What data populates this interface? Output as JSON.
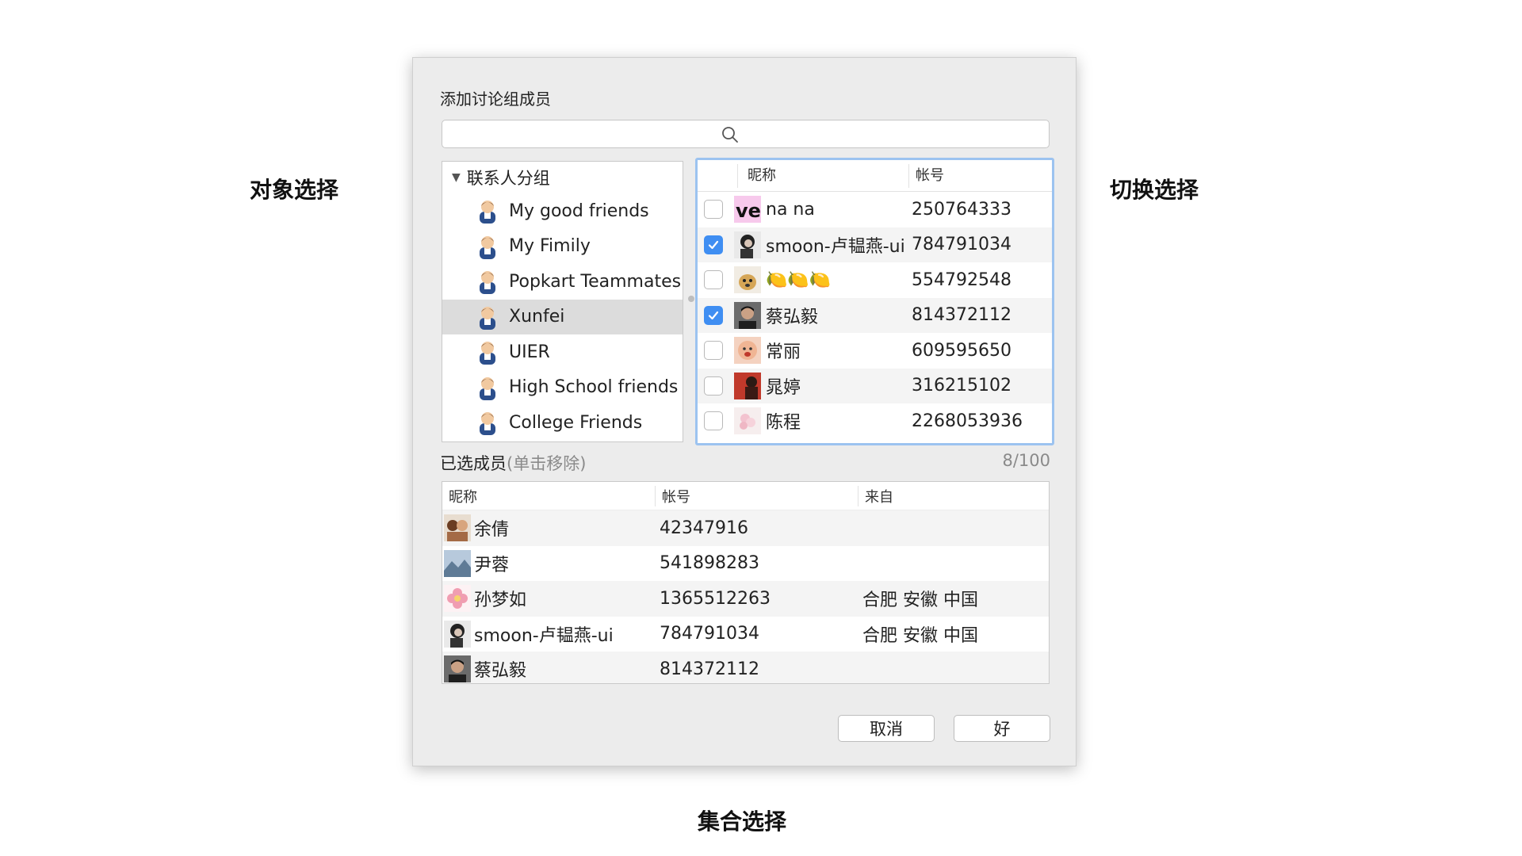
{
  "annotations": {
    "left": "对象选择",
    "right": "切换选择",
    "bottom": "集合选择"
  },
  "dialog": {
    "title": "添加讨论组成员",
    "search_placeholder": ""
  },
  "groups": {
    "header": "联系人分组",
    "items": [
      {
        "label": "My  good  friends",
        "selected": false
      },
      {
        "label": "My  Fimily",
        "selected": false
      },
      {
        "label": "Popkart Teammates",
        "selected": false
      },
      {
        "label": "Xunfei",
        "selected": true
      },
      {
        "label": "UIER",
        "selected": false
      },
      {
        "label": "High School friends",
        "selected": false
      },
      {
        "label": "College Friends",
        "selected": false
      }
    ]
  },
  "contacts": {
    "col_nick": "昵称",
    "col_account": "帐号",
    "rows": [
      {
        "nick": "na na",
        "account": "250764333",
        "checked": false,
        "avatar": "ve-logo-avatar"
      },
      {
        "nick": "smoon-卢韫燕-ui",
        "account": "784791034",
        "checked": true,
        "avatar": "girl-avatar"
      },
      {
        "nick": "🍋🍋🍋",
        "account": "554792548",
        "checked": false,
        "avatar": "dog-avatar"
      },
      {
        "nick": "蔡弘毅",
        "account": "814372112",
        "checked": true,
        "avatar": "man-avatar"
      },
      {
        "nick": "常丽",
        "account": "609595650",
        "checked": false,
        "avatar": "baby-avatar"
      },
      {
        "nick": "晁婷",
        "account": "316215102",
        "checked": false,
        "avatar": "red-avatar"
      },
      {
        "nick": "陈程",
        "account": "2268053936",
        "checked": false,
        "avatar": "flower-avatar"
      }
    ]
  },
  "selected": {
    "title": "已选成员",
    "hint": "(单击移除)",
    "count": "8/100",
    "col_nick": "昵称",
    "col_account": "帐号",
    "col_from": "来自",
    "rows": [
      {
        "nick": "余倩",
        "account": "42347916",
        "from": "",
        "avatar": "couple-avatar"
      },
      {
        "nick": "尹蓉",
        "account": "541898283",
        "from": "",
        "avatar": "landscape-avatar"
      },
      {
        "nick": "孙梦如",
        "account": "1365512263",
        "from": "合肥 安徽 中国",
        "avatar": "pink-flower-avatar"
      },
      {
        "nick": "smoon-卢韫燕-ui",
        "account": "784791034",
        "from": "合肥 安徽 中国",
        "avatar": "girl-avatar"
      },
      {
        "nick": "蔡弘毅",
        "account": "814372112",
        "from": "",
        "avatar": "man-avatar"
      }
    ]
  },
  "buttons": {
    "cancel": "取消",
    "ok": "好"
  },
  "colors": {
    "accent": "#3f8ef2",
    "focus_ring": "#9cc3f0",
    "dialog_bg": "#ececec"
  }
}
